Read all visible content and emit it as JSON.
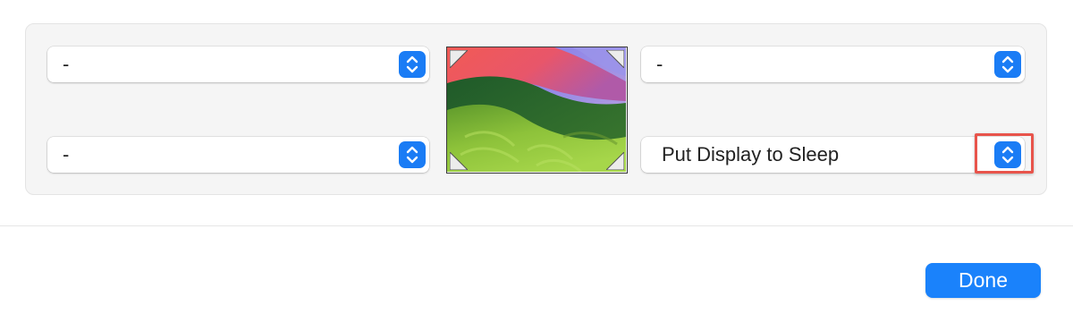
{
  "hot_corners": {
    "top_left": {
      "value": "-"
    },
    "bottom_left": {
      "value": "-"
    },
    "top_right": {
      "value": "-"
    },
    "bottom_right": {
      "value": "Put Display to Sleep"
    }
  },
  "footer": {
    "done_label": "Done"
  },
  "colors": {
    "accent": "#1a82fb",
    "highlight": "#e8544b"
  },
  "icons": {
    "stepper": "chevron-up-down-icon",
    "corner": "corner-triangle-icon"
  }
}
